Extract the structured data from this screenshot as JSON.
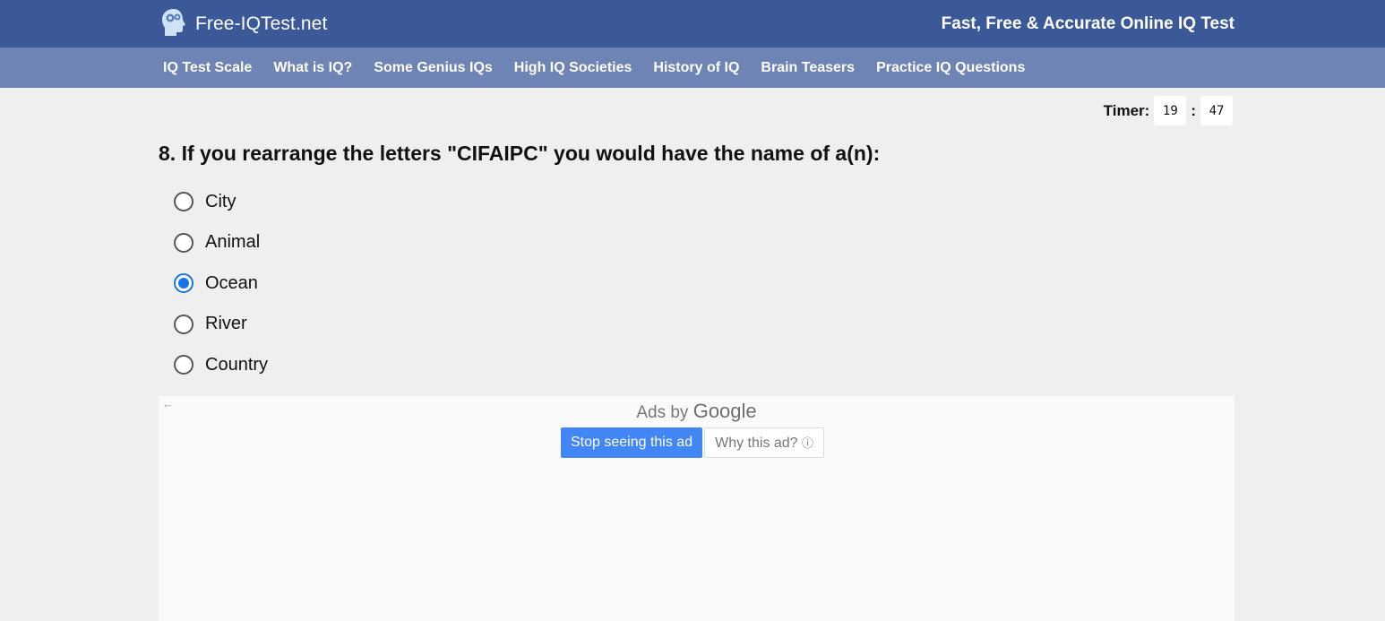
{
  "header": {
    "logo_text": "Free-IQTest.net",
    "tagline": "Fast, Free & Accurate Online IQ Test"
  },
  "nav": {
    "items": [
      "IQ Test Scale",
      "What is IQ?",
      "Some Genius IQs",
      "High IQ Societies",
      "History of IQ",
      "Brain Teasers",
      "Practice IQ Questions"
    ]
  },
  "timer": {
    "label": "Timer:",
    "minutes": "19",
    "separator": ":",
    "seconds": "47"
  },
  "question": {
    "text": "8. If you rearrange the letters \"CIFAIPC\" you would have the name of a(n):",
    "options": [
      "City",
      "Animal",
      "Ocean",
      "River",
      "Country"
    ],
    "selected": "Ocean"
  },
  "ad": {
    "back_arrow": "←",
    "ads_by": "Ads by",
    "google": "Google",
    "stop_button": "Stop seeing this ad",
    "why_button": "Why this ad?",
    "info_glyph": "ⓘ"
  },
  "colors": {
    "header_bg": "#3b5998",
    "nav_bg": "#6d84b4",
    "radio_selected": "#1a73e8",
    "ad_button": "#4285f4"
  },
  "icons": {
    "logo": "head-with-gears-icon"
  }
}
